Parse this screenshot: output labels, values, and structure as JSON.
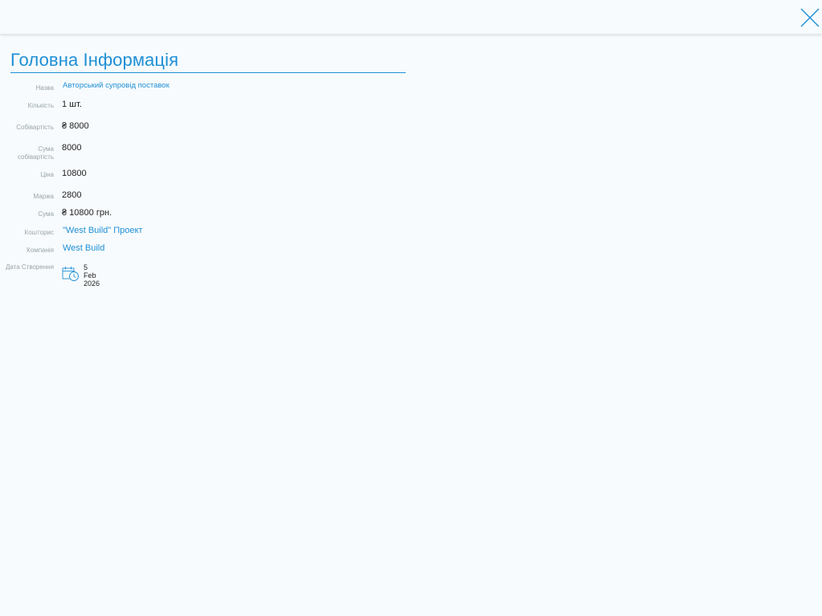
{
  "header": {
    "close_icon": "close-icon",
    "accent_color": "#1f8fd6"
  },
  "section": {
    "title": "Головна Інформація"
  },
  "fields": {
    "name": {
      "label": "Назва",
      "value": "Авторський супровід поставок"
    },
    "quantity": {
      "label": "Кількість",
      "value": "1 шт."
    },
    "cost": {
      "label": "Собівартість",
      "value": "₴ 8000"
    },
    "cost_sum": {
      "label_line1": "Сума",
      "label_line2": "собівартість",
      "value": "8000"
    },
    "price": {
      "label": "Ціна",
      "value": "10800"
    },
    "margin": {
      "label": "Маржа",
      "value": "2800"
    },
    "sum": {
      "label": "Сума",
      "value": "₴ 10800 грн."
    },
    "estimate": {
      "label": "Кошторис",
      "value": "\"West Build\" Проект"
    },
    "company": {
      "label": "Компанія",
      "value": "West Build"
    },
    "created": {
      "label": "Дата Створення",
      "value": "5 Feb 2026",
      "icon": "calendar-clock-icon"
    }
  }
}
